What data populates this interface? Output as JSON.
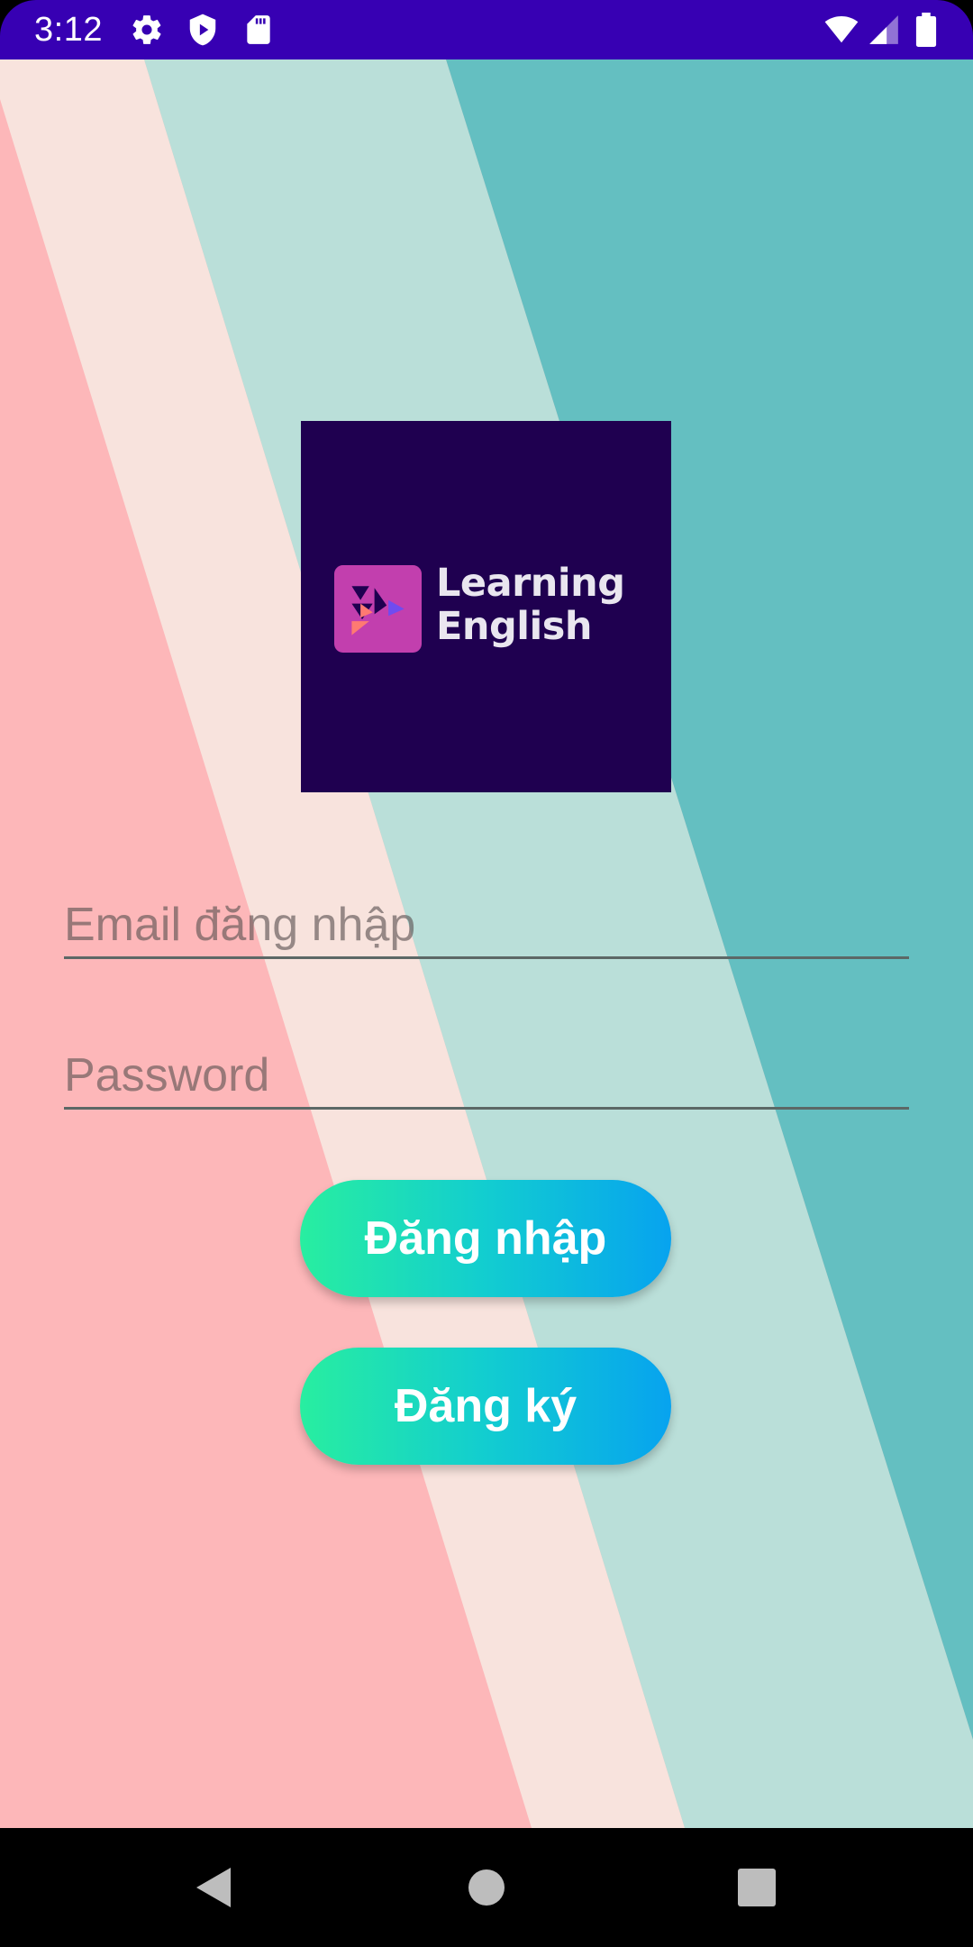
{
  "status_bar": {
    "time": "3:12",
    "icons": [
      "gear-icon",
      "shield-play-icon",
      "sd-card-icon",
      "wifi-icon",
      "signal-icon",
      "battery-icon"
    ],
    "background_color": "#3700b3"
  },
  "logo": {
    "line1": "Learning",
    "line2": "English",
    "background_color": "#1f0050",
    "mark_color": "#c23fae"
  },
  "form": {
    "email_placeholder": "Email đăng nhập",
    "email_value": "",
    "password_placeholder": "Password",
    "password_value": ""
  },
  "buttons": {
    "login_label": "Đăng nhập",
    "register_label": "Đăng ký"
  },
  "colors": {
    "stripe_pink": "#fdb7b9",
    "stripe_cream": "#f8e3dd",
    "stripe_mint": "#badfd9",
    "stripe_teal": "#64bfc1",
    "button_gradient_start": "#28eea0",
    "button_gradient_end": "#07a3ef"
  },
  "nav_bar": {
    "icons": [
      "back-icon",
      "home-icon",
      "recents-icon"
    ]
  }
}
